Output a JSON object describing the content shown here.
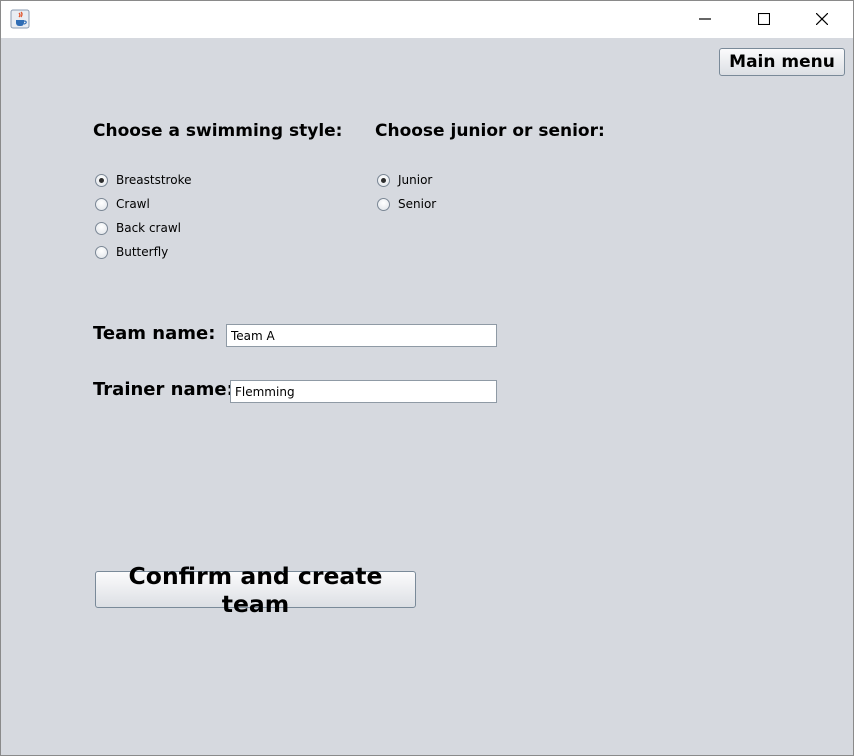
{
  "window": {
    "icons": {
      "app": "java-cup-icon",
      "minimize": "minimize-icon",
      "maximize": "maximize-icon",
      "close": "close-icon"
    }
  },
  "toolbar": {
    "main_menu_label": "Main menu"
  },
  "swimming_style": {
    "title": "Choose a swimming style:",
    "options": [
      {
        "label": "Breaststroke",
        "checked": true
      },
      {
        "label": "Crawl",
        "checked": false
      },
      {
        "label": "Back crawl",
        "checked": false
      },
      {
        "label": "Butterfly",
        "checked": false
      }
    ]
  },
  "age_group": {
    "title": "Choose junior or senior:",
    "options": [
      {
        "label": "Junior",
        "checked": true
      },
      {
        "label": "Senior",
        "checked": false
      }
    ]
  },
  "form": {
    "team_label": "Team name:",
    "team_value": "Team A",
    "trainer_label": "Trainer name:",
    "trainer_value": "Flemming"
  },
  "actions": {
    "confirm_label": "Confirm and create team"
  },
  "colors": {
    "background": "#d6d9df",
    "titlebar": "#ffffff"
  }
}
